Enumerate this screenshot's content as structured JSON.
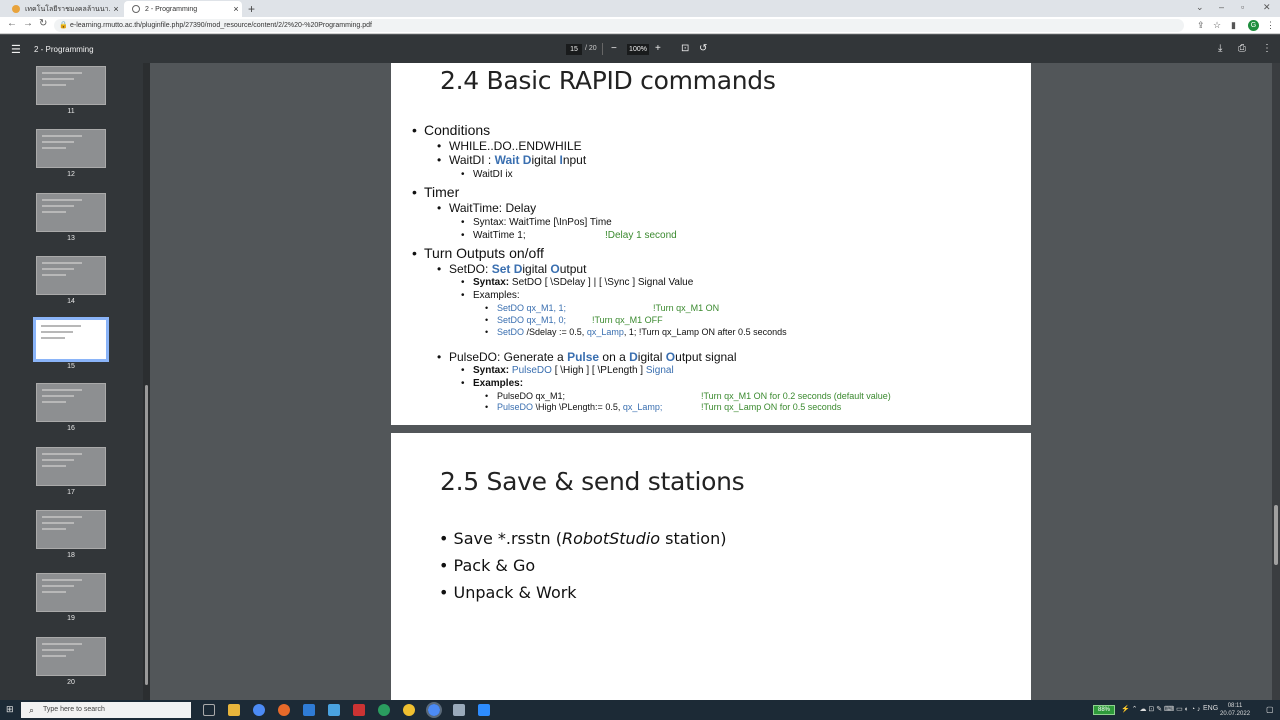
{
  "browser": {
    "tabs": [
      {
        "title": "เทคโนโลยีราชมงคลล้านนา..."
      },
      {
        "title": "2 - Programming"
      }
    ],
    "new_tab": "+",
    "url": "e-learning.rmutto.ac.th/pluginfile.php/27390/mod_resource/content/2/2%20-%20Programming.pdf",
    "profile_initial": "G"
  },
  "pdf_toolbar": {
    "title": "2 - Programming",
    "current_page": "15",
    "total_pages": "/ 20",
    "zoom": "100%"
  },
  "thumbnails": [
    {
      "num": "11"
    },
    {
      "num": "12"
    },
    {
      "num": "13"
    },
    {
      "num": "14"
    },
    {
      "num": "15"
    },
    {
      "num": "16"
    },
    {
      "num": "17"
    },
    {
      "num": "18"
    },
    {
      "num": "19"
    },
    {
      "num": "20"
    }
  ],
  "slide1": {
    "title": "2.4 Basic RAPID commands",
    "conditions": "Conditions",
    "while": "WHILE..DO..ENDWHILE",
    "waitdi_pre": "WaitDI : ",
    "waitdi_w": "Wait",
    "waitdi_d": "D",
    "waitdi_mid": "igital ",
    "waitdi_i": "I",
    "waitdi_end": "nput",
    "waitdi_ix": "WaitDI ix",
    "timer": "Timer",
    "waittime": "WaitTime: Delay",
    "waittime_syntax": "Syntax: WaitTime [\\InPos] Time",
    "waittime_ex": "WaitTime 1;",
    "waittime_comment": "!Delay 1 second",
    "turn_outputs": "Turn Outputs on/off",
    "setdo_pre": "SetDO: ",
    "setdo_set": "Set",
    "setdo_d": "D",
    "setdo_mid": "igital ",
    "setdo_o": "O",
    "setdo_end": "utput",
    "setdo_syntax_label": "Syntax:",
    "setdo_syntax": " SetDO [ \\SDelay ] | [ \\Sync ] Signal Value",
    "examples": "Examples:",
    "ex1_code": "SetDO qx_M1, 1;",
    "ex1_comment": "!Turn qx_M1 ON",
    "ex2_code": "SetDO qx_M1, 0;",
    "ex2_comment": "!Turn qx_M1 OFF",
    "ex3_a": "SetDO",
    "ex3_b": " /Sdelay := 0.5, ",
    "ex3_c": "qx_Lamp",
    "ex3_d": ", 1;  !Turn qx_Lamp ON after 0.5 seconds",
    "pulse_pre": "PulseDO: Generate a ",
    "pulse_p": "Pulse",
    "pulse_on": " on a ",
    "pulse_d": "D",
    "pulse_igital": "igital ",
    "pulse_o": "O",
    "pulse_end": "utput signal",
    "pulse_syntax_label": "Syntax:",
    "pulse_syntax_cmd": "PulseDO",
    "pulse_syntax_mid": " [ \\High ] [ \\PLength ] ",
    "pulse_syntax_sig": "Signal",
    "pulse_examples": "Examples:",
    "pex1_code": "PulseDO qx_M1;",
    "pex1_comment": "!Turn qx_M1 ON for 0.2 seconds (default value)",
    "pex2_a": "PulseDO",
    "pex2_b": " \\High \\PLength:= 0.5, ",
    "pex2_c": "qx_Lamp;",
    "pex2_comment": "!Turn qx_Lamp ON for 0.5 seconds"
  },
  "slide2": {
    "title": "2.5 Save & send stations",
    "item1_pre": "Save *.rsstn (",
    "item1_em": "RobotStudio",
    "item1_post": " station)",
    "item2": "Pack & Go",
    "item3": "Unpack & Work"
  },
  "taskbar": {
    "search_placeholder": "Type here to search",
    "battery": "88%",
    "lang": "ENG",
    "time": "08:11",
    "date": "20.07.2022"
  },
  "colors": {
    "accent_blue": "#3a6fb0",
    "comment_green": "#3b8a2f",
    "pdf_toolbar": "#323639",
    "viewer_bg": "#525659"
  }
}
